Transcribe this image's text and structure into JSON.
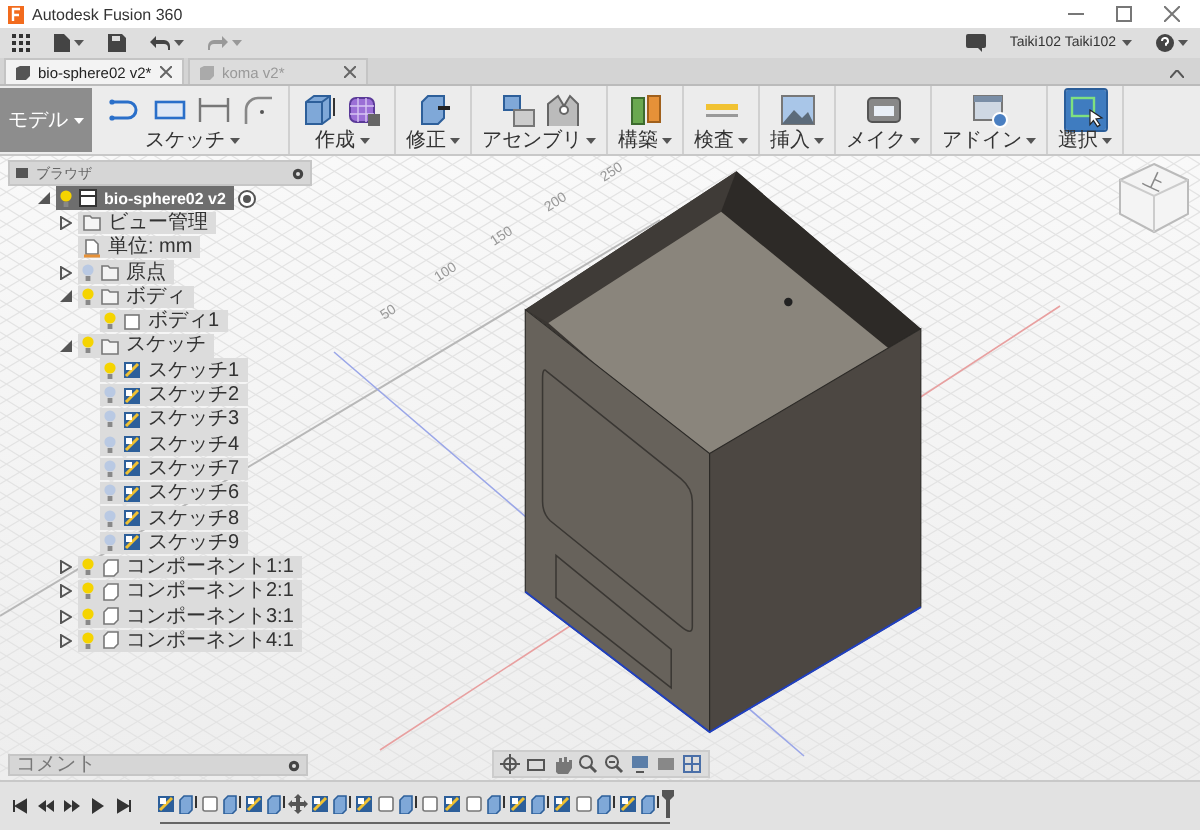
{
  "window": {
    "title": "Autodesk Fusion 360"
  },
  "account": {
    "user": "Taiki102 Taiki102"
  },
  "tabs": [
    {
      "label": "bio-sphere02 v2*",
      "selected": true
    },
    {
      "label": "koma v2*",
      "selected": false
    }
  ],
  "ribbon": {
    "workspace": "モデル",
    "groups": [
      {
        "label": "スケッチ",
        "active": false
      },
      {
        "label": "作成",
        "active": false
      },
      {
        "label": "修正",
        "active": false
      },
      {
        "label": "アセンブリ",
        "active": false
      },
      {
        "label": "構築",
        "active": false
      },
      {
        "label": "検査",
        "active": false
      },
      {
        "label": "挿入",
        "active": false
      },
      {
        "label": "メイク",
        "active": false
      },
      {
        "label": "アドイン",
        "active": false
      },
      {
        "label": "選択",
        "active": true
      }
    ]
  },
  "browser": {
    "title": "ブラウザ",
    "tree": [
      {
        "label": "bio-sphere02 v2",
        "kind": "document",
        "selected": true,
        "visible": true,
        "expanded": true,
        "children": [
          {
            "label": "ビュー管理",
            "kind": "folder",
            "selected": false,
            "expanded": false
          },
          {
            "label": "単位: mm",
            "kind": "units",
            "selected": false
          },
          {
            "label": "原点",
            "kind": "folder",
            "selected": false,
            "visible": false,
            "expanded": false
          },
          {
            "label": "ボディ",
            "kind": "folder",
            "selected": false,
            "visible": true,
            "expanded": true,
            "children": [
              {
                "label": "ボディ1",
                "kind": "body",
                "selected": false,
                "visible": true
              }
            ]
          },
          {
            "label": "スケッチ",
            "kind": "folder",
            "selected": false,
            "visible": true,
            "expanded": true,
            "children": [
              {
                "label": "スケッチ1",
                "kind": "sketch",
                "selected": false,
                "visible": true
              },
              {
                "label": "スケッチ2",
                "kind": "sketch",
                "selected": false,
                "visible": false
              },
              {
                "label": "スケッチ3",
                "kind": "sketch",
                "selected": false,
                "visible": false
              },
              {
                "label": "スケッチ4",
                "kind": "sketch",
                "selected": false,
                "visible": false
              },
              {
                "label": "スケッチ7",
                "kind": "sketch",
                "selected": false,
                "visible": false
              },
              {
                "label": "スケッチ6",
                "kind": "sketch",
                "selected": false,
                "visible": false
              },
              {
                "label": "スケッチ8",
                "kind": "sketch",
                "selected": false,
                "visible": false
              },
              {
                "label": "スケッチ9",
                "kind": "sketch",
                "selected": false,
                "visible": false
              }
            ]
          },
          {
            "label": "コンポーネント1:1",
            "kind": "component",
            "selected": false,
            "visible": true,
            "expanded": false
          },
          {
            "label": "コンポーネント2:1",
            "kind": "component",
            "selected": false,
            "visible": true,
            "expanded": false
          },
          {
            "label": "コンポーネント3:1",
            "kind": "component",
            "selected": false,
            "visible": true,
            "expanded": false
          },
          {
            "label": "コンポーネント4:1",
            "kind": "component",
            "selected": false,
            "visible": true,
            "expanded": false
          }
        ]
      }
    ]
  },
  "viewport": {
    "grid_labels": [
      "250",
      "200",
      "150",
      "100",
      "50"
    ],
    "viewcube": "上"
  },
  "comments": {
    "title": "コメント"
  },
  "timeline": {
    "features": [
      {
        "kind": "sketch"
      },
      {
        "kind": "extrude"
      },
      {
        "kind": "body"
      },
      {
        "kind": "extrude"
      },
      {
        "kind": "sketch"
      },
      {
        "kind": "extrude"
      },
      {
        "kind": "move"
      },
      {
        "kind": "sketch"
      },
      {
        "kind": "extrude"
      },
      {
        "kind": "sketch"
      },
      {
        "kind": "body"
      },
      {
        "kind": "extrude"
      },
      {
        "kind": "body"
      },
      {
        "kind": "sketch"
      },
      {
        "kind": "body"
      },
      {
        "kind": "extrude"
      },
      {
        "kind": "sketch"
      },
      {
        "kind": "extrude"
      },
      {
        "kind": "sketch"
      },
      {
        "kind": "body"
      },
      {
        "kind": "extrude"
      },
      {
        "kind": "sketch"
      },
      {
        "kind": "extrude"
      }
    ]
  }
}
